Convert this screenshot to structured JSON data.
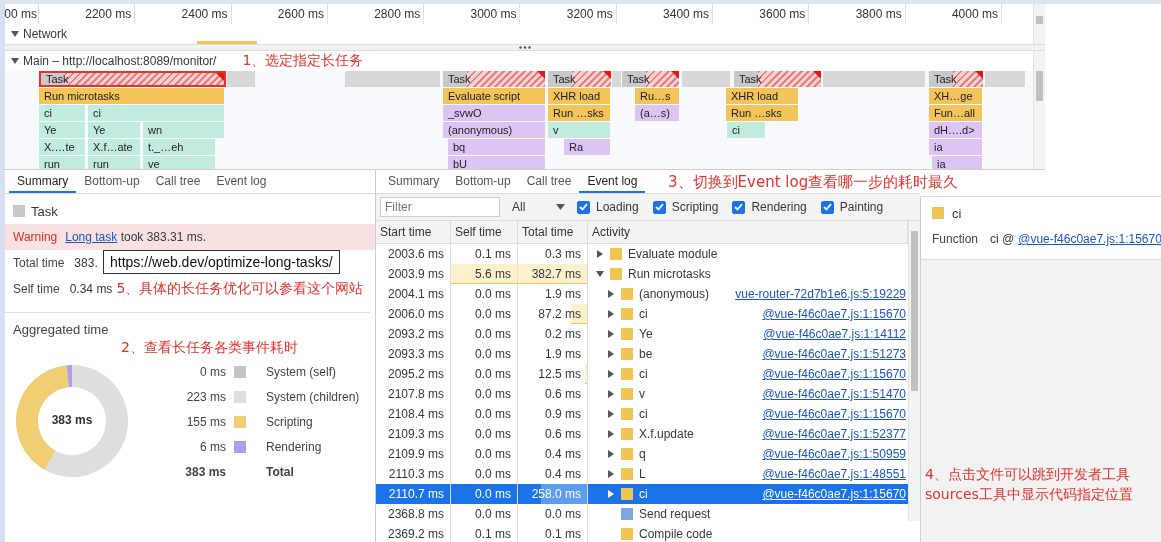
{
  "timeline": {
    "ruler": [
      "00 ms",
      "2200 ms",
      "2400 ms",
      "2600 ms",
      "2800 ms",
      "3000 ms",
      "3200 ms",
      "3400 ms",
      "3600 ms",
      "3800 ms",
      "4000 ms"
    ],
    "network": {
      "label": "Network",
      "expanded": true
    },
    "main": {
      "label": "Main – http://localhost:8089/monitor/",
      "expanded": true,
      "annotation": "1、选定指定长任务"
    },
    "flame_rows": [
      [
        {
          "label": "Task",
          "kind": "long-task",
          "selected": true
        },
        {
          "label": "Task",
          "kind": "long-task",
          "selected": false
        },
        {
          "label": "Task",
          "kind": "long-task",
          "selected": false
        },
        {
          "label": "Task",
          "kind": "long-task",
          "selected": false
        },
        {
          "label": "Task",
          "kind": "long-task",
          "selected": false
        },
        {
          "label": "Task",
          "kind": "long-task",
          "selected": false
        }
      ],
      [
        {
          "label": "Run microtasks",
          "kind": "scripting",
          "selected": false
        },
        {
          "label": "Evaluate script",
          "kind": "scripting",
          "selected": false
        },
        {
          "label": "XHR load",
          "kind": "scripting",
          "selected": false
        },
        {
          "label": "Ru…s",
          "kind": "scripting",
          "selected": false
        },
        {
          "label": "XHR load",
          "kind": "scripting",
          "selected": false
        },
        {
          "label": "XH…ge",
          "kind": "scripting",
          "selected": false
        }
      ],
      [
        {
          "label": "ci",
          "kind": "function",
          "selected": false
        },
        {
          "label": "ci",
          "kind": "function",
          "selected": false
        },
        {
          "label": "_svwO",
          "kind": "compile",
          "selected": false
        },
        {
          "label": "Run …sks",
          "kind": "scripting",
          "selected": false
        },
        {
          "label": "(a…s)",
          "kind": "compile",
          "selected": false
        },
        {
          "label": "Run …sks",
          "kind": "scripting",
          "selected": false
        },
        {
          "label": "Fun…all",
          "kind": "scripting",
          "selected": false
        }
      ],
      [
        {
          "label": "Ye",
          "kind": "function",
          "selected": false
        },
        {
          "label": "Ye",
          "kind": "function",
          "selected": false
        },
        {
          "label": "wn",
          "kind": "function",
          "selected": false
        },
        {
          "label": "(anonymous)",
          "kind": "compile",
          "selected": false
        },
        {
          "label": "v",
          "kind": "function",
          "selected": false
        },
        {
          "label": "ci",
          "kind": "function",
          "selected": false
        },
        {
          "label": "dH….d>",
          "kind": "compile",
          "selected": false
        }
      ],
      [
        {
          "label": "X.…te",
          "kind": "function",
          "selected": false
        },
        {
          "label": "X.f…ate",
          "kind": "function",
          "selected": false
        },
        {
          "label": "t._…eh",
          "kind": "function",
          "selected": false
        },
        {
          "label": "bq",
          "kind": "compile",
          "selected": false
        },
        {
          "label": "Ra",
          "kind": "compile",
          "selected": false
        },
        {
          "label": "ia",
          "kind": "compile",
          "selected": false
        }
      ],
      [
        {
          "label": "run",
          "kind": "function",
          "selected": false
        },
        {
          "label": "run",
          "kind": "function",
          "selected": false
        },
        {
          "label": "ve",
          "kind": "function",
          "selected": false
        },
        {
          "label": "bU",
          "kind": "compile",
          "selected": false
        },
        {
          "label": "ia",
          "kind": "compile",
          "selected": false
        }
      ]
    ]
  },
  "summary_panel": {
    "tabs": [
      {
        "label": "Summary",
        "selected": true
      },
      {
        "label": "Bottom-up",
        "selected": false
      },
      {
        "label": "Call tree",
        "selected": false
      },
      {
        "label": "Event log",
        "selected": false
      }
    ],
    "title": "Task",
    "warning": {
      "label": "Warning",
      "link": "Long task",
      "text": "took 383.31 ms."
    },
    "total_time": {
      "label": "Total time",
      "value": "383."
    },
    "tooltip": "https://web.dev/optimize-long-tasks/",
    "self_time": {
      "label": "Self time",
      "value": "0.34 ms",
      "annotation": "5、具体的长任务优化可以参看这个网站"
    },
    "aggregated": {
      "title": "Aggregated time",
      "annotation": "2、查看长任务各类事件耗时",
      "center_label": "383 ms",
      "chart_data": {
        "type": "donut",
        "categories": [
          "System (self)",
          "System (children)",
          "Scripting",
          "Rendering"
        ],
        "values": [
          0,
          58.1,
          40.4,
          1.5
        ]
      },
      "legend": [
        {
          "value": "0 ms",
          "color": "#c4c4c4"
        },
        {
          "value": "223 ms",
          "color": "#dedede"
        },
        {
          "value": "155 ms",
          "color": "#f1cd74"
        },
        {
          "value": "6 ms",
          "color": "#ae9ced"
        }
      ],
      "total": {
        "value": "383 ms",
        "label": "Total"
      }
    }
  },
  "event_log": {
    "tabs": [
      {
        "label": "Summary",
        "selected": false
      },
      {
        "label": "Bottom-up",
        "selected": false
      },
      {
        "label": "Call tree",
        "selected": false
      },
      {
        "label": "Event log",
        "selected": true
      }
    ],
    "annotation": "3、切换到Event log查看哪一步的耗时最久",
    "filter": {
      "placeholder": "Filter"
    },
    "category": "All",
    "checkboxes": [
      {
        "label": "Loading",
        "checked": true
      },
      {
        "label": "Scripting",
        "checked": true
      },
      {
        "label": "Rendering",
        "checked": true
      },
      {
        "label": "Painting",
        "checked": true
      }
    ],
    "columns": [
      "Start time",
      "Self time",
      "Total time",
      "Activity"
    ],
    "rows": [
      {
        "start": "2003.6 ms",
        "self": {
          "text": "0.1 ms"
        },
        "total": {
          "text": "0.3 ms"
        },
        "activity": "Evaluate module",
        "kind": "group",
        "expanded": false,
        "selected": false,
        "color": "#f1c453"
      },
      {
        "start": "2003.9 ms",
        "self": {
          "text": "5.6 ms",
          "level": 1
        },
        "total": {
          "text": "382.7 ms",
          "level": 1
        },
        "activity": "Run microtasks",
        "kind": "group",
        "expanded": true,
        "selected": false,
        "color": "#f1c453",
        "children": [
          {
            "start": "2004.1 ms",
            "self": {
              "text": "0.0 ms"
            },
            "total": {
              "text": "1.9 ms"
            },
            "activity": "(anonymous)",
            "source": "vue-router-72d7b1e6.js:5:19229",
            "kind": "group",
            "expanded": false,
            "selected": false,
            "color": "#f1c453"
          },
          {
            "start": "2006.0 ms",
            "self": {
              "text": "0.0 ms"
            },
            "total": {
              "text": "87.2 ms",
              "level": 0.23
            },
            "activity": "ci",
            "source": "@vue-f46c0ae7.js:1:15670",
            "kind": "group",
            "expanded": false,
            "selected": false,
            "color": "#f1c453"
          },
          {
            "start": "2093.2 ms",
            "self": {
              "text": "0.0 ms"
            },
            "total": {
              "text": "0.2 ms"
            },
            "activity": "Ye",
            "source": "@vue-f46c0ae7.js:1:14112",
            "kind": "group",
            "expanded": false,
            "selected": false,
            "color": "#f1c453"
          },
          {
            "start": "2093.3 ms",
            "self": {
              "text": "0.0 ms"
            },
            "total": {
              "text": "1.9 ms"
            },
            "activity": "be",
            "source": "@vue-f46c0ae7.js:1:51273",
            "kind": "group",
            "expanded": false,
            "selected": false,
            "color": "#f1c453"
          },
          {
            "start": "2095.2 ms",
            "self": {
              "text": "0.0 ms"
            },
            "total": {
              "text": "12.5 ms",
              "level": 0.03
            },
            "activity": "ci",
            "source": "@vue-f46c0ae7.js:1:15670",
            "kind": "group",
            "expanded": false,
            "selected": false,
            "color": "#f1c453"
          },
          {
            "start": "2107.8 ms",
            "self": {
              "text": "0.0 ms"
            },
            "total": {
              "text": "0.6 ms"
            },
            "activity": "v",
            "source": "@vue-f46c0ae7.js:1:51470",
            "kind": "group",
            "expanded": false,
            "selected": false,
            "color": "#f1c453"
          },
          {
            "start": "2108.4 ms",
            "self": {
              "text": "0.0 ms"
            },
            "total": {
              "text": "0.9 ms"
            },
            "activity": "ci",
            "source": "@vue-f46c0ae7.js:1:15670",
            "kind": "group",
            "expanded": false,
            "selected": false,
            "color": "#f1c453"
          },
          {
            "start": "2109.3 ms",
            "self": {
              "text": "0.0 ms"
            },
            "total": {
              "text": "0.6 ms"
            },
            "activity": "X.f.update",
            "source": "@vue-f46c0ae7.js:1:52377",
            "kind": "group",
            "expanded": false,
            "selected": false,
            "color": "#f1c453"
          },
          {
            "start": "2109.9 ms",
            "self": {
              "text": "0.0 ms"
            },
            "total": {
              "text": "0.4 ms"
            },
            "activity": "q",
            "source": "@vue-f46c0ae7.js:1:50959",
            "kind": "group",
            "expanded": false,
            "selected": false,
            "color": "#f1c453"
          },
          {
            "start": "2110.3 ms",
            "self": {
              "text": "0.0 ms"
            },
            "total": {
              "text": "0.4 ms"
            },
            "activity": "L",
            "source": "@vue-f46c0ae7.js:1:48551",
            "kind": "group",
            "expanded": false,
            "selected": false,
            "color": "#f1c453"
          },
          {
            "start": "2110.7 ms",
            "self": {
              "text": "0.0 ms"
            },
            "total": {
              "text": "258.0 ms",
              "level": 0.67
            },
            "activity": "ci",
            "source": "@vue-f46c0ae7.js:1:15670",
            "kind": "group",
            "expanded": false,
            "selected": true,
            "color": "#f1c453"
          },
          {
            "start": "2368.8 ms",
            "self": {
              "text": "0.0 ms"
            },
            "total": {
              "text": "0.0 ms"
            },
            "activity": "Send request",
            "kind": "event",
            "selected": false,
            "color": "#7ea6e0"
          },
          {
            "start": "2369.2 ms",
            "self": {
              "text": "0.1 ms"
            },
            "total": {
              "text": "0.1 ms"
            },
            "activity": "Compile code",
            "kind": "event",
            "selected": false,
            "color": "#f1c453"
          }
        ]
      }
    ]
  },
  "details": {
    "title": "ci",
    "label": "Function",
    "value": "ci @",
    "link": "@vue-f46c0ae7.js:1:15670",
    "annotation": [
      "4、点击文件可以跳到开发者工具",
      "sources工具中显示代码指定位置"
    ]
  }
}
